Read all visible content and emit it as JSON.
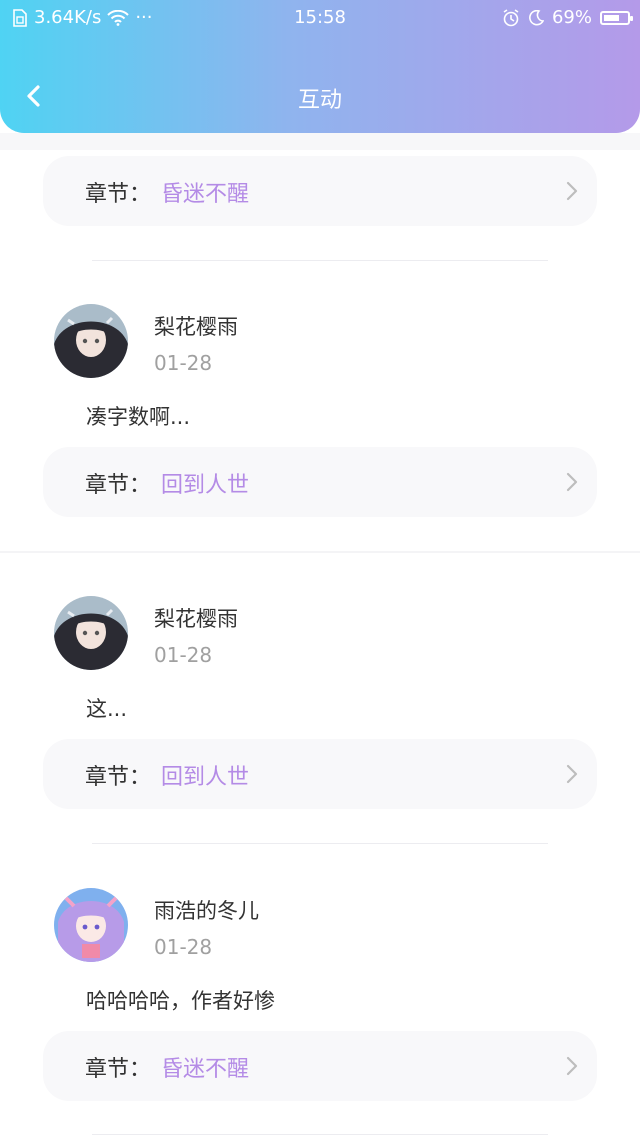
{
  "status": {
    "network_speed": "3.64K/s",
    "more": "···",
    "time": "15:58",
    "battery": "69%",
    "battery_level": 0.69
  },
  "nav": {
    "title": "互动",
    "back_icon": "chevron-left-icon"
  },
  "chapter_label": "章节：",
  "items": [
    {
      "chapter": "昏迷不醒"
    },
    {
      "username": "梨花樱雨",
      "date": "01-28",
      "comment": "凑字数啊...",
      "chapter": "回到人世"
    },
    {
      "username": "梨花樱雨",
      "date": "01-28",
      "comment": "这...",
      "chapter": "回到人世"
    },
    {
      "username": "雨浩的冬儿",
      "date": "01-28",
      "comment": "哈哈哈哈，作者好惨",
      "chapter": "昏迷不醒"
    }
  ],
  "colors": {
    "gradient_start": "#4fd3f3",
    "gradient_end": "#b49ae9",
    "chapter_name": "#b48be6"
  }
}
